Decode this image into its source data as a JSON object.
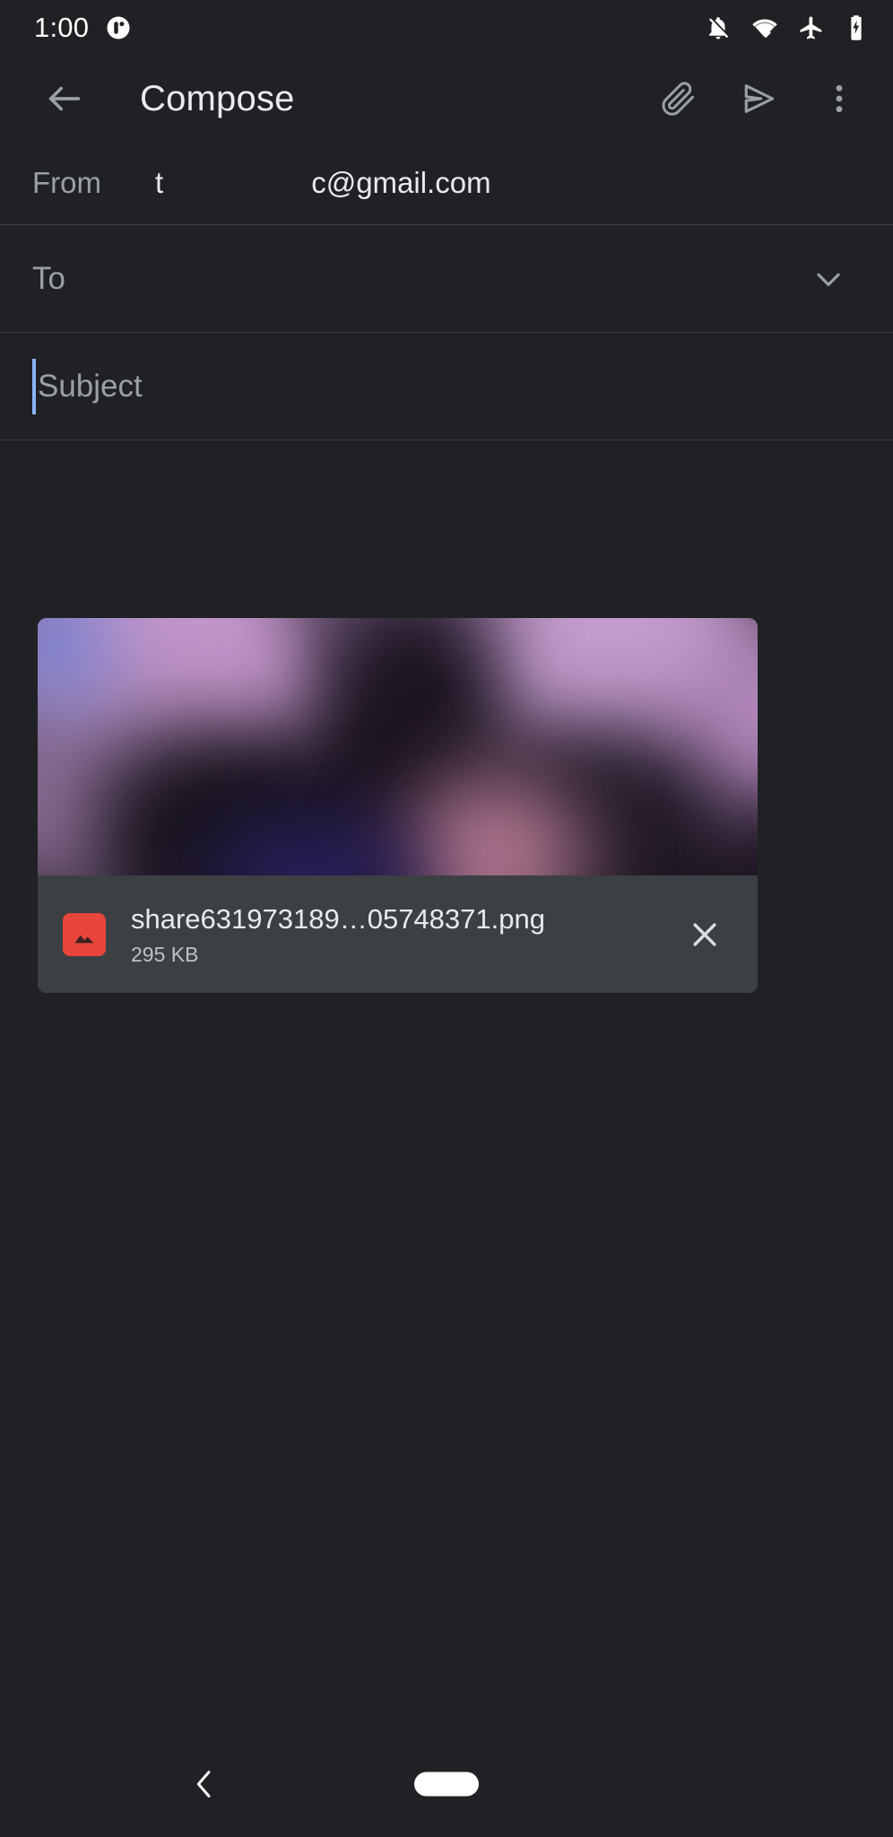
{
  "status_bar": {
    "time": "1:00",
    "left_icons": [
      {
        "name": "app-notification-icon"
      }
    ],
    "right_icons": [
      {
        "name": "notifications-off-icon"
      },
      {
        "name": "wifi-icon"
      },
      {
        "name": "airplane-mode-icon"
      },
      {
        "name": "battery-charging-icon"
      }
    ]
  },
  "app_bar": {
    "back_label": "Back",
    "title": "Compose",
    "actions": [
      {
        "name": "attach-icon",
        "label": "Attach file"
      },
      {
        "name": "send-icon",
        "label": "Send"
      },
      {
        "name": "more-options-icon",
        "label": "More options"
      }
    ]
  },
  "fields": {
    "from": {
      "label": "From",
      "value": "t                  c@gmail.com"
    },
    "to": {
      "placeholder": "To",
      "value": "",
      "expand_icon": "chevron-down-icon"
    },
    "subject": {
      "placeholder": "Subject",
      "value": "",
      "cursor_color": "#8ab4f8"
    },
    "body": {
      "placeholder": "",
      "value": ""
    }
  },
  "attachment": {
    "file_name": "share631973189…05748371.png",
    "file_size": "295 KB",
    "file_type_icon": "image-file-icon",
    "file_icon_color": "#e8453c",
    "remove_label": "Remove attachment",
    "thumbnail_alt": "blurred purple image preview"
  },
  "nav_bar": {
    "back_label": "Back",
    "home_label": "Home"
  },
  "colors": {
    "background": "#202124",
    "divider": "#3c4043",
    "card": "#3c4043",
    "primary_text": "#e8eaed",
    "secondary_text": "#9aa0a6",
    "accent": "#8ab4f8"
  }
}
